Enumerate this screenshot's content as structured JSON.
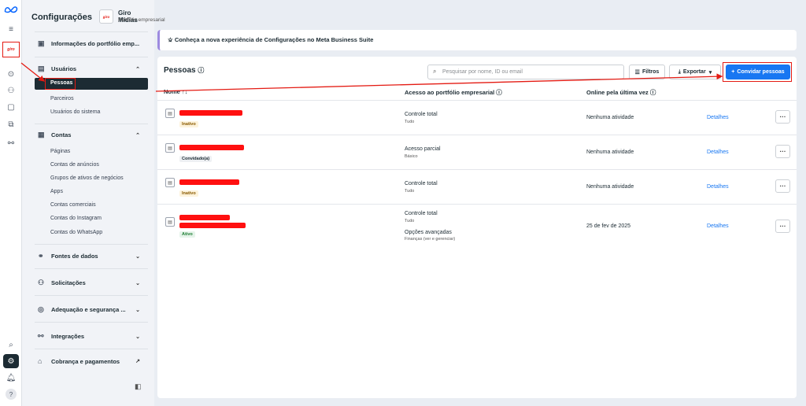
{
  "app": {
    "title": "Configurações"
  },
  "business": {
    "name": "Giro Mídias",
    "subtitle": "Portfólio empresarial",
    "logo_text": "giro"
  },
  "sidebar": {
    "portfolio_info": "Informações do portfólio emp...",
    "users": {
      "label": "Usuários",
      "items": [
        "Pessoas",
        "Parceiros",
        "Usuários do sistema"
      ]
    },
    "accounts": {
      "label": "Contas",
      "items": [
        "Páginas",
        "Contas de anúncios",
        "Grupos de ativos de negócios",
        "Apps",
        "Contas comerciais",
        "Contas do Instagram",
        "Contas do WhatsApp"
      ]
    },
    "data_sources": "Fontes de dados",
    "requests": "Solicitações",
    "compliance": "Adequação e segurança ...",
    "integrations": "Integrações",
    "billing": "Cobrança e pagamentos"
  },
  "banner": {
    "text": "Conheça a nova experiência de Configurações no Meta Business Suite"
  },
  "main": {
    "title": "Pessoas",
    "search_placeholder": "Pesquisar por nome, ID ou email",
    "filters": "Filtros",
    "export": "Exportar",
    "invite": "Convidar pessoas",
    "columns": {
      "name": "Nome",
      "access": "Acesso ao portfólio empresarial",
      "online": "Online pela última vez"
    },
    "rows": [
      {
        "status": "Inativo",
        "access": "Controle total",
        "access_sub": "Tudo",
        "online": "Nenhuma atividade",
        "details": "Detalhes"
      },
      {
        "status": "Convidado(a)",
        "access": "Acesso parcial",
        "access_sub": "Básico",
        "online": "Nenhuma atividade",
        "details": "Detalhes"
      },
      {
        "status": "Inativo",
        "access": "Controle total",
        "access_sub": "Tudo",
        "online": "Nenhuma atividade",
        "details": "Detalhes"
      },
      {
        "status": "Ativo",
        "access": "Controle total",
        "access_sub": "Tudo",
        "access2": "Opções avançadas",
        "access2_sub": "Finanças (ver e gerenciar)",
        "online": "25 de fev de 2025",
        "details": "Detalhes"
      }
    ]
  },
  "colors": {
    "accent": "#1877f2",
    "annotation": "#e41b13",
    "active": "#1c2b33"
  }
}
